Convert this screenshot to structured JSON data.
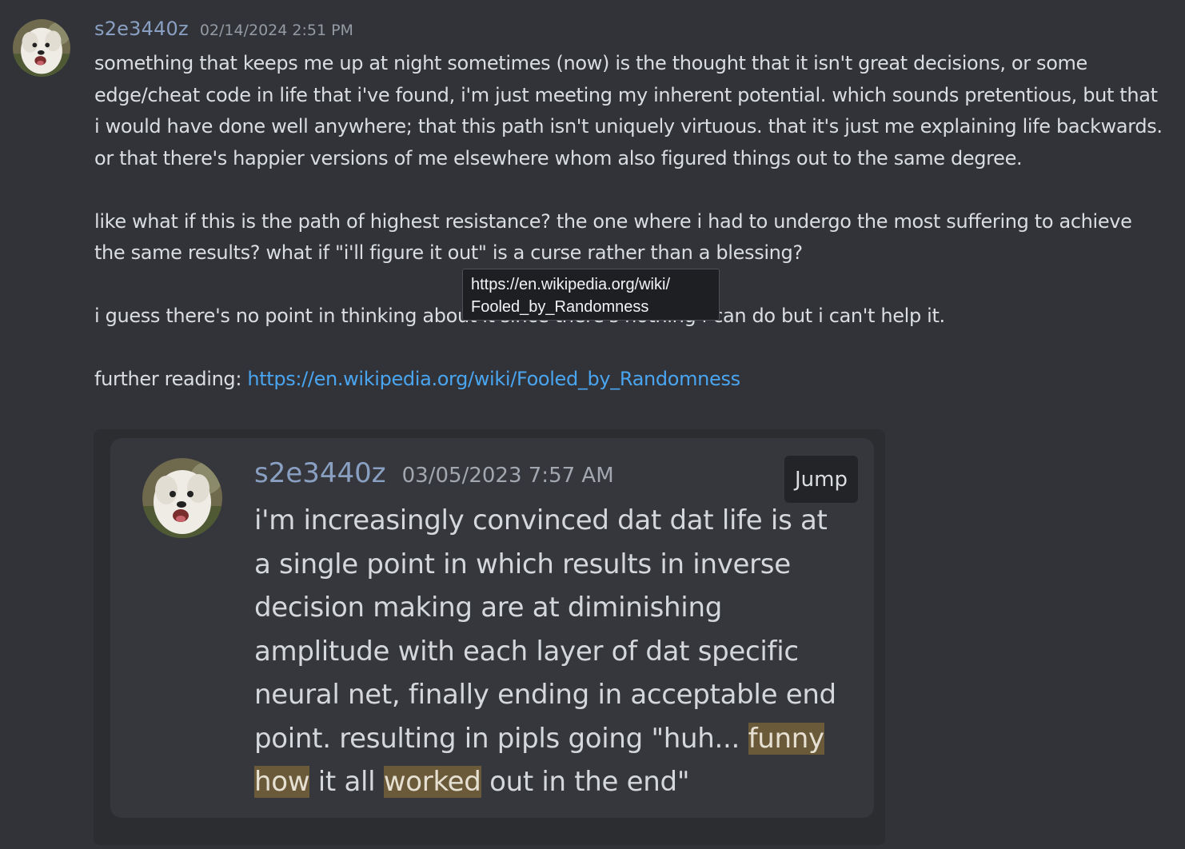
{
  "message": {
    "username": "s2e3440z",
    "timestamp": "02/14/2024 2:51 PM",
    "avatar_icon": "dog-avatar-icon",
    "paragraphs": [
      "something that keeps me up at night sometimes (now) is the thought that it isn't great decisions, or some edge/cheat code in life that i've found, i'm just meeting my inherent potential. which sounds pretentious, but that i would have done well anywhere; that this path isn't uniquely virtuous. that it's just me explaining life backwards. or that there's happier versions of me elsewhere whom also figured things out to the same degree.",
      "like what if this is the path of highest resistance? the one where i had to undergo the most suffering to achieve the same results? what if \"i'll figure it out\" is a curse rather than a blessing?",
      "i guess there's no point in thinking about it since there's nothing i can do but i can't help it."
    ],
    "further_label": "further reading: ",
    "link_text": "https://en.wikipedia.org/wiki/Fooled_by_Randomness"
  },
  "tooltip": {
    "line1": "https://en.wikipedia.org/wiki/",
    "line2": "Fooled_by_Randomness"
  },
  "embed": {
    "username": "s2e3440z",
    "timestamp": "03/05/2023 7:57 AM",
    "jump_label": "Jump",
    "avatar_icon": "dog-avatar-icon",
    "body_segments": [
      {
        "text": "i'm increasingly convinced dat dat life is at a single point in which results in inverse decision making are at diminishing amplitude with each layer of dat specific neural net, finally ending in acceptable end point. resulting in pipls going \"huh... ",
        "highlight": false
      },
      {
        "text": "funny",
        "highlight": true
      },
      {
        "text": " ",
        "highlight": false
      },
      {
        "text": "how",
        "highlight": true
      },
      {
        "text": " it all ",
        "highlight": false
      },
      {
        "text": "worked",
        "highlight": true
      },
      {
        "text": " out in the end\"",
        "highlight": false
      }
    ]
  },
  "colors": {
    "background": "#313338",
    "username": "#8aa0c2",
    "link": "#4aa5f0",
    "highlight": "#6b5a3a"
  }
}
